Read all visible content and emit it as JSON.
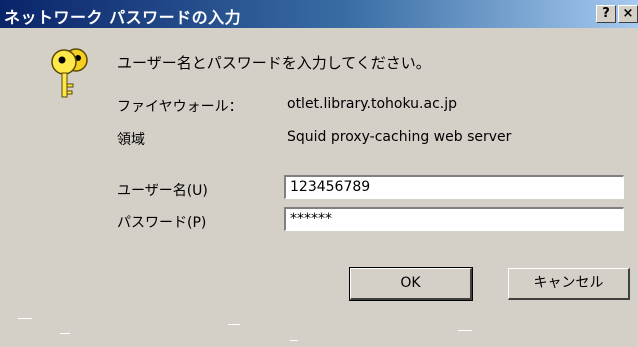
{
  "window": {
    "title": "ネットワーク パスワードの入力",
    "help_label": "?",
    "close_label": "×"
  },
  "prompt": "ユーザー名とパスワードを入力してください。",
  "info": {
    "firewall_label": "ファイヤウォール：",
    "firewall_value": "otlet.library.tohoku.ac.jp",
    "realm_label": "領域",
    "realm_value": "Squid proxy-caching web server"
  },
  "form": {
    "username_label": "ユーザー名(U)",
    "username_value": "123456789",
    "password_label": "パスワード(P)",
    "password_value": "******"
  },
  "buttons": {
    "ok_label": "OK",
    "cancel_label": "キャンセル"
  },
  "colors": {
    "titlebar_start": "#0a246a",
    "titlebar_end": "#a6caf0",
    "dialog_bg": "#d4d0c8"
  }
}
